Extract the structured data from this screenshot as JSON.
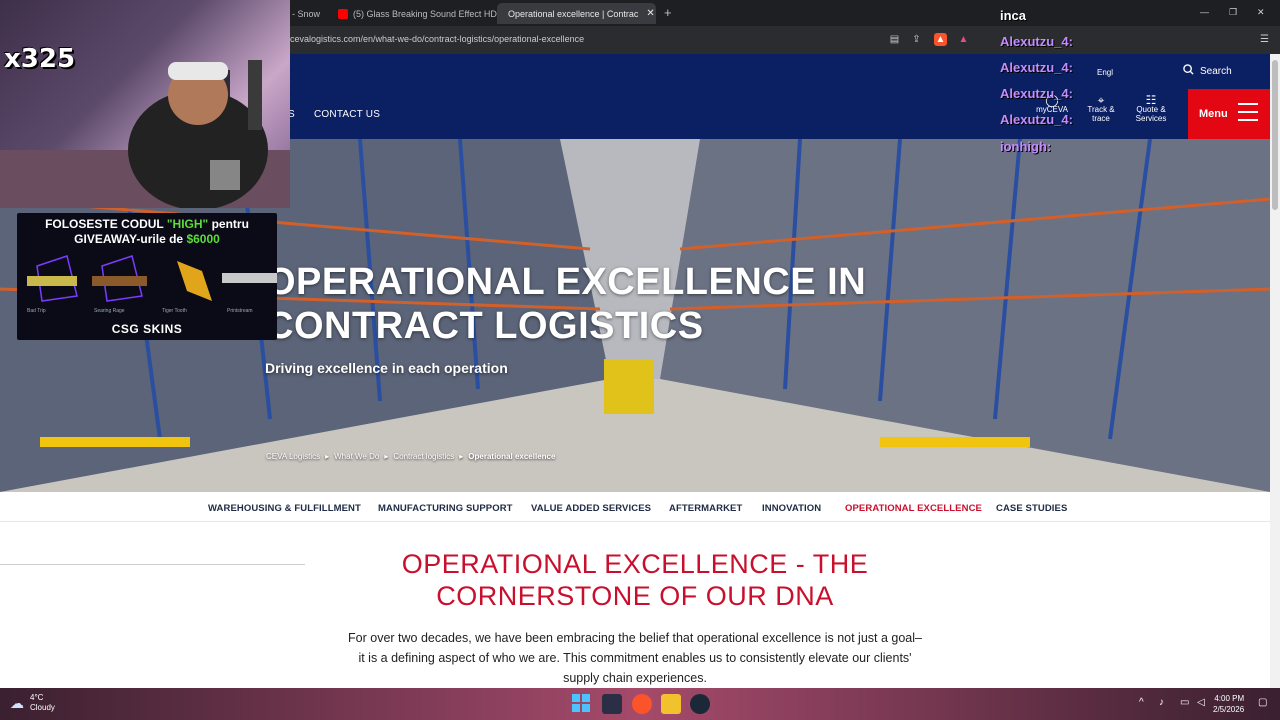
{
  "browser": {
    "tabs": [
      {
        "title": "- Snow",
        "active": false
      },
      {
        "title": "(5) Glass Breaking Sound Effect HD |",
        "active": false
      },
      {
        "title": "Operational excellence | Contrac",
        "active": true
      }
    ],
    "url": "cevalogistics.com/en/what-we-do/contract-logistics/operational-excellence"
  },
  "site": {
    "nav_partial": "S",
    "contact": "CONTACT US",
    "search": "Search",
    "language": "Engl",
    "tools": [
      {
        "label1": "myCEVA",
        "label2": ""
      },
      {
        "label1": "Track &",
        "label2": "trace"
      },
      {
        "label1": "Quote &",
        "label2": "Services"
      }
    ],
    "menu": "Menu",
    "brand_color": "#e30613",
    "header_color": "#0b1f63"
  },
  "hero": {
    "title_line1": "OPERATIONAL EXCELLENCE IN",
    "title_line2": "CONTRACT LOGISTICS",
    "subtitle": "Driving excellence in each operation",
    "breadcrumb": [
      "CEVA Logistics",
      "What We Do",
      "Contract logistics",
      "Operational excellence"
    ]
  },
  "subnav": [
    {
      "label": "WAREHOUSING & FULFILLMENT",
      "active": false
    },
    {
      "label": "MANUFACTURING SUPPORT",
      "active": false
    },
    {
      "label": "VALUE ADDED SERVICES",
      "active": false
    },
    {
      "label": "AFTERMARKET",
      "active": false
    },
    {
      "label": "INNOVATION",
      "active": false
    },
    {
      "label": "OPERATIONAL EXCELLENCE",
      "active": true
    },
    {
      "label": "CASE STUDIES",
      "active": false
    }
  ],
  "content": {
    "title_line1": "OPERATIONAL EXCELLENCE - THE",
    "title_line2": "CORNERSTONE OF OUR DNA",
    "body_line1": "For over two decades, we have been embracing the belief that operational excellence is not just a goal–",
    "body_line2": "it is a defining aspect of who we are. This commitment enables us to consistently elevate our clients'",
    "body_line3": "supply chain experiences."
  },
  "overlay": {
    "counter": "x325",
    "promo_line1_a": "FOLOSESTE CODUL ",
    "promo_line1_code": "\"HIGH\"",
    "promo_line1_b": " pentru",
    "promo_line2_a": "GIVEAWAY-urile de ",
    "promo_line2_amount": "$6000",
    "skins": [
      "Bad Trip",
      "Searing Rage",
      "Tiger Tooth",
      "Printstream"
    ],
    "promo_brand": "CSG SKINS",
    "chat_top": "inca",
    "chat_lines": [
      "Alexutzu_4:",
      "Alexutzu_4:",
      "Alexutzu_4:",
      "Alexutzu_4:",
      "ionhigh:"
    ]
  },
  "taskbar": {
    "temp": "4°C",
    "weather": "Cloudy",
    "time": "4:00 PM",
    "date": "2/5/2026"
  }
}
